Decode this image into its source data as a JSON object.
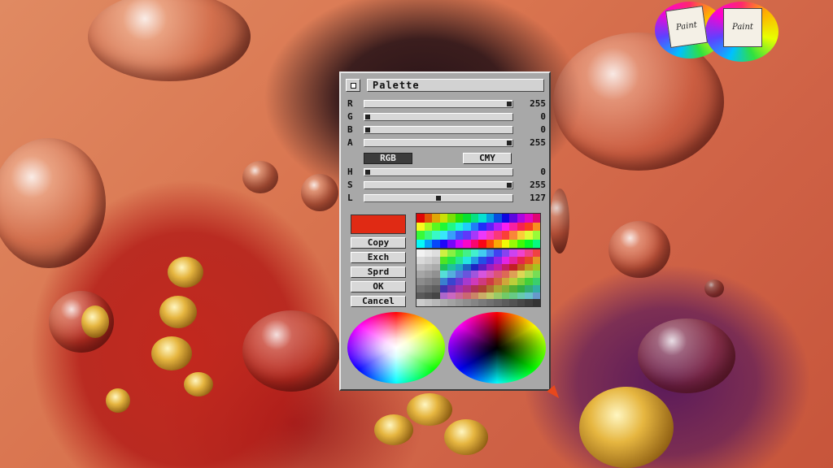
{
  "window": {
    "title": "Palette"
  },
  "sliders_rgb": [
    {
      "label": "R",
      "value": "255",
      "level": 1.0
    },
    {
      "label": "G",
      "value": "0",
      "level": 0.0
    },
    {
      "label": "B",
      "value": "0",
      "level": 0.0
    },
    {
      "label": "A",
      "value": "255",
      "level": 1.0
    }
  ],
  "mode": {
    "rgb_label": "RGB",
    "cmy_label": "CMY",
    "selected": "RGB"
  },
  "sliders_hsl": [
    {
      "label": "H",
      "value": "0",
      "level": 0.0
    },
    {
      "label": "S",
      "value": "255",
      "level": 1.0
    },
    {
      "label": "L",
      "value": "127",
      "level": 0.5
    }
  ],
  "current_color": "#e02a14",
  "buttons": {
    "copy": "Copy",
    "exch": "Exch",
    "sprd": "Sprd",
    "ok": "OK",
    "cancel": "Cancel"
  },
  "logo": {
    "left_text": "Paint",
    "right_text": "Paint"
  }
}
